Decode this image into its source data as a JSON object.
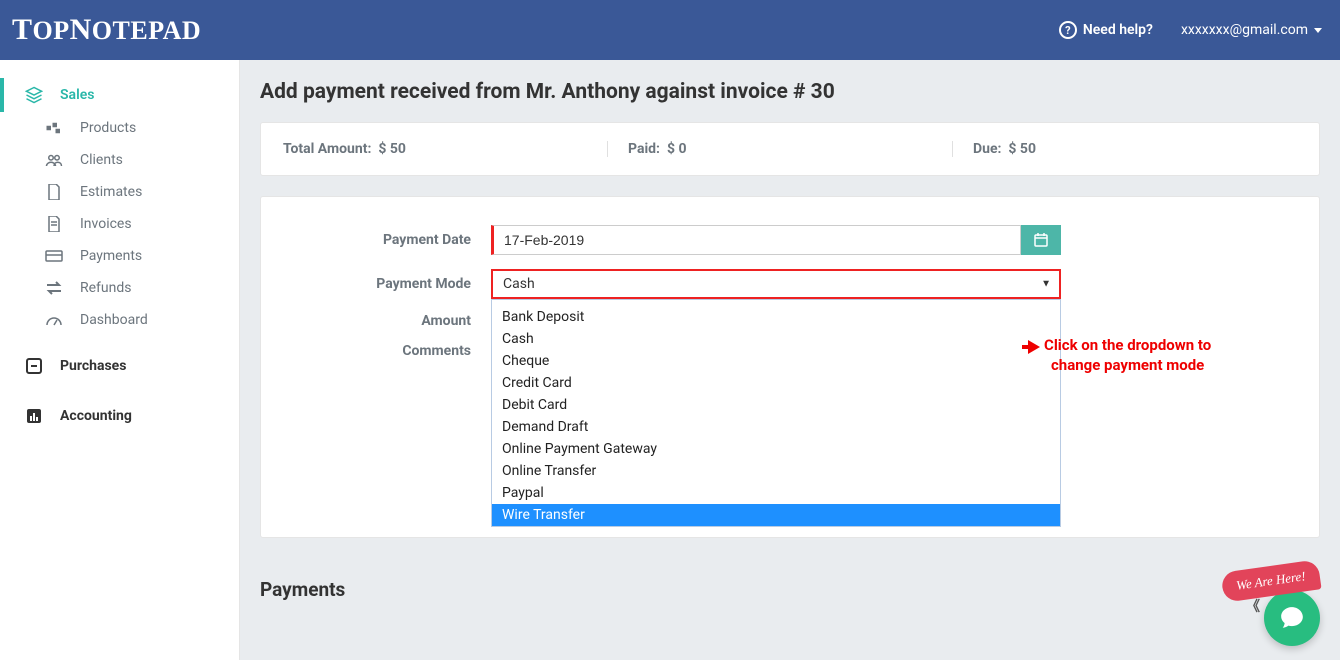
{
  "header": {
    "logo": "TopNotepad",
    "help_label": "Need help?",
    "user_email": "xxxxxxx@gmail.com"
  },
  "sidebar": {
    "items": [
      {
        "label": "Sales",
        "icon": "layers",
        "active": true,
        "sub": false
      },
      {
        "label": "Products",
        "icon": "cubes",
        "active": false,
        "sub": true
      },
      {
        "label": "Clients",
        "icon": "users",
        "active": false,
        "sub": true
      },
      {
        "label": "Estimates",
        "icon": "file",
        "active": false,
        "sub": true
      },
      {
        "label": "Invoices",
        "icon": "file-text",
        "active": false,
        "sub": true
      },
      {
        "label": "Payments",
        "icon": "credit-card",
        "active": false,
        "sub": true
      },
      {
        "label": "Refunds",
        "icon": "exchange",
        "active": false,
        "sub": true
      },
      {
        "label": "Dashboard",
        "icon": "gauge",
        "active": false,
        "sub": true
      },
      {
        "label": "Purchases",
        "icon": "minus-box",
        "active": false,
        "sub": false,
        "bold": true
      },
      {
        "label": "Accounting",
        "icon": "bar-chart",
        "active": false,
        "sub": false,
        "bold": true
      }
    ]
  },
  "page": {
    "title": "Add payment received from Mr. Anthony against invoice # 30"
  },
  "summary": {
    "total_label": "Total Amount:",
    "total_value": "$ 50",
    "paid_label": "Paid:",
    "paid_value": "$ 0",
    "due_label": "Due:",
    "due_value": "$ 50"
  },
  "form": {
    "payment_date_label": "Payment Date",
    "payment_date_value": "17-Feb-2019",
    "payment_mode_label": "Payment Mode",
    "payment_mode_value": "Cash",
    "amount_label": "Amount",
    "comments_label": "Comments",
    "mode_options": [
      "Bank Deposit",
      "Cash",
      "Cheque",
      "Credit Card",
      "Debit Card",
      "Demand Draft",
      "Online Payment Gateway",
      "Online Transfer",
      "Paypal",
      "Wire Transfer"
    ],
    "highlighted_option_index": 9
  },
  "annotation": {
    "text_line1": "Click on the dropdown to",
    "text_line2": "change payment mode"
  },
  "sections": {
    "payments_title": "Payments"
  },
  "chat": {
    "banner": "We Are Here!"
  }
}
